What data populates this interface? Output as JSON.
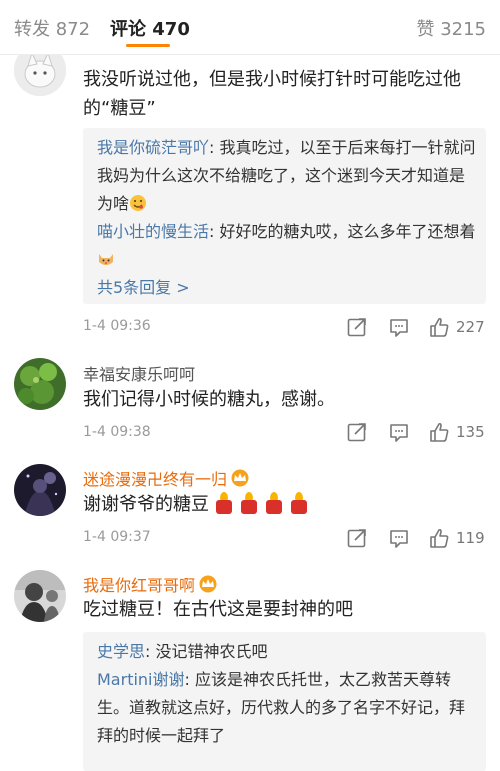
{
  "tabs": {
    "repost": "转发 872",
    "comment": "评论 470",
    "like": "赞 3215"
  },
  "comments": [
    {
      "text": "我没听说过他，但是我小时候打针时可能吃过他的“糖豆”",
      "time": "1-4 09:36",
      "likes": "227",
      "replies": [
        {
          "name": "我是你硫茫哥吖",
          "text": ": 我真吃过，以至于后来每打一针就问我妈为什么这次不给糖吃了，这个迷到今天才知道是为啥"
        },
        {
          "name": "喵小壮的慢生活",
          "text": ": 好好吃的糖丸哎，这么多年了还想着"
        }
      ],
      "more": "共5条回复 >"
    },
    {
      "name": "幸福安康乐呵呵",
      "text": "我们记得小时候的糖丸，感谢。",
      "time": "1-4 09:38",
      "likes": "135"
    },
    {
      "name": "迷途漫漫卍终有一归",
      "text": "谢谢爷爷的糖豆",
      "time": "1-4 09:37",
      "likes": "119"
    },
    {
      "name": "我是你红哥哥啊",
      "text": "吃过糖豆！在古代这是要封神的吧",
      "replies": [
        {
          "name": "史学思",
          "text": ": 没记错神农氏吧"
        },
        {
          "name": "Martini谢谢",
          "text": ": 应该是神农氏托世，太乙救苦天尊转生。道教就这点好，历代救人的多了名字不好记，拜拜的时候一起拜了"
        }
      ]
    }
  ],
  "colors": {
    "accent": "#ff8200",
    "link": "#4a78a8",
    "vip_name": "#e86b0c"
  },
  "icons": {
    "repost": "repost-icon",
    "comment": "comment-icon",
    "like": "thumbs-up-icon"
  }
}
